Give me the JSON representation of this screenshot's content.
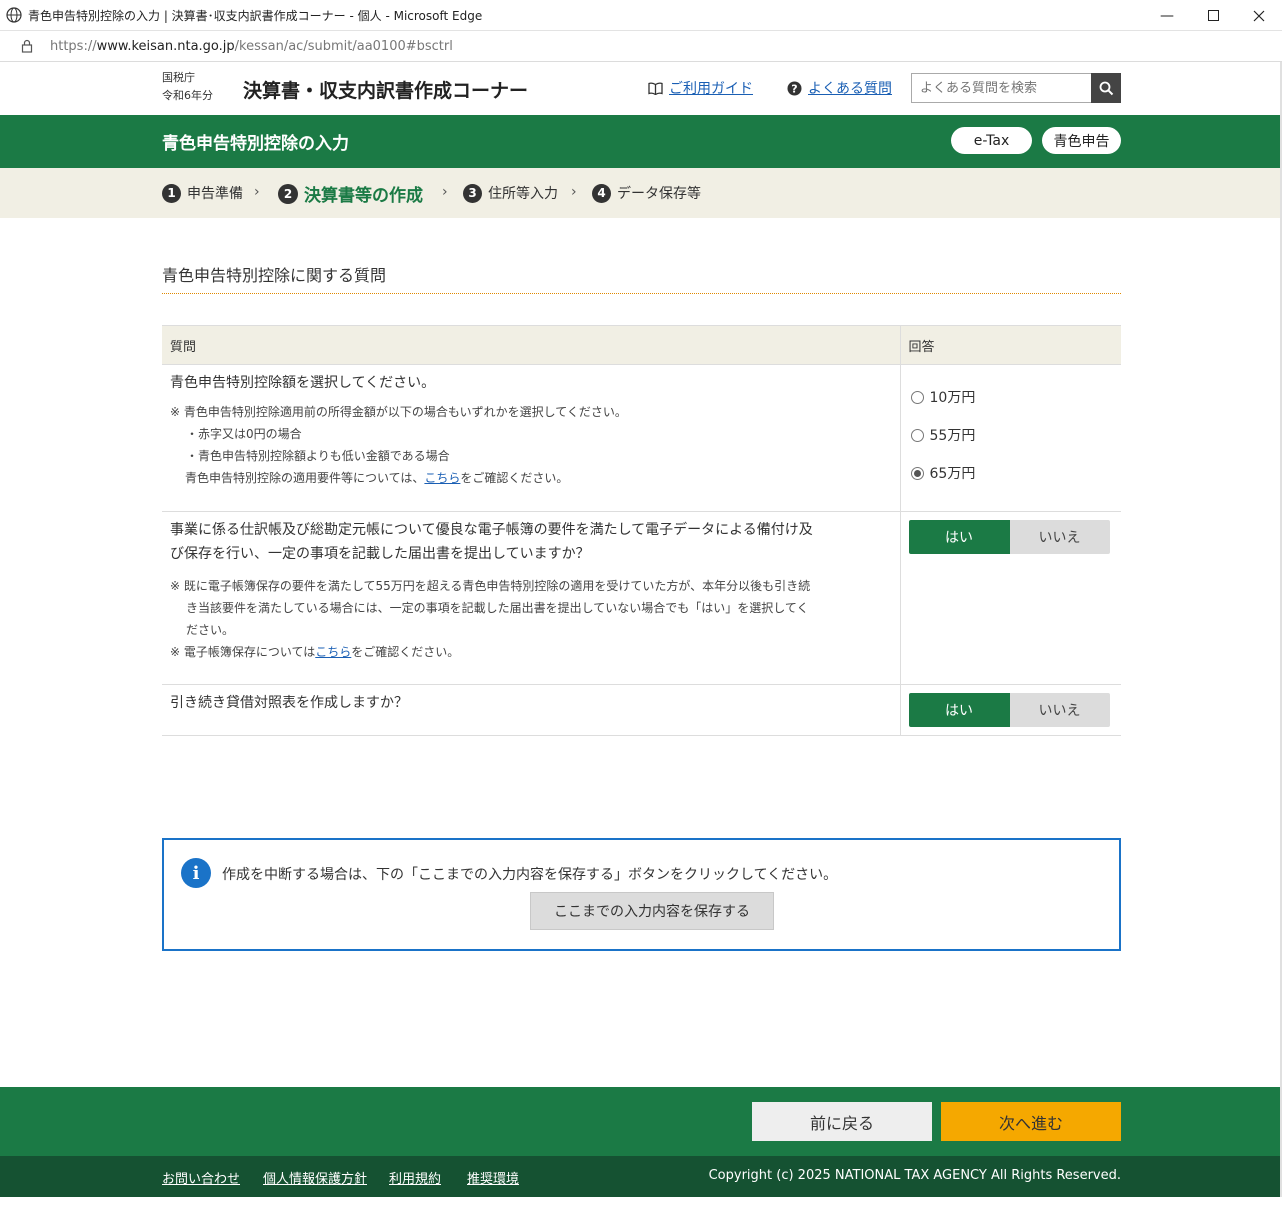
{
  "window": {
    "title": "青色申告特別控除の入力 | 決算書･収支内訳書作成コーナー - 個人 - Microsoft Edge",
    "url_prefix": "https://",
    "url_host": "www.keisan.nta.go.jp",
    "url_path": "/kessan/ac/submit/aa0100#bsctrl"
  },
  "header": {
    "agency": "国税庁",
    "year": "令和6年分",
    "corner_title": "決算書・収支内訳書作成コーナー",
    "guide_link": "ご利用ガイド",
    "faq_link": "よくある質問",
    "search_placeholder": "よくある質問を検索"
  },
  "band": {
    "page_title": "青色申告特別控除の入力",
    "etax_label": "e-Tax",
    "aoiro_label": "青色申告"
  },
  "steps": [
    {
      "num": "1",
      "label": "申告準備"
    },
    {
      "num": "2",
      "label": "決算書等の作成"
    },
    {
      "num": "3",
      "label": "住所等入力"
    },
    {
      "num": "4",
      "label": "データ保存等"
    }
  ],
  "main": {
    "section_title": "青色申告特別控除に関する質問",
    "col_question": "質問",
    "col_answer": "回答",
    "q1": {
      "text": "青色申告特別控除額を選択してください。",
      "note1": "※ 青色申告特別控除適用前の所得金額が以下の場合もいずれかを選択してください。",
      "note2": "・赤字又は0円の場合",
      "note3": "・青色申告特別控除額よりも低い金額である場合",
      "note4_pre": "青色申告特別控除の適用要件等については、",
      "note4_link": "こちら",
      "note4_post": "をご確認ください。",
      "options": [
        "10万円",
        "55万円",
        "65万円"
      ],
      "selected": "65万円"
    },
    "q2": {
      "text1": "事業に係る仕訳帳及び総勘定元帳について優良な電子帳簿の要件を満たして電子データによる備付け及",
      "text2": "び保存を行い、一定の事項を記載した届出書を提出していますか？",
      "note1": "※ 既に電子帳簿保存の要件を満たして55万円を超える青色申告特別控除の適用を受けていた方が、本年分以後も引き続",
      "note2": "き当該要件を満たしている場合には、一定の事項を記載した届出書を提出していない場合でも「はい」を選択してく",
      "note3": "ださい。",
      "note4_pre": "※ 電子帳簿保存については",
      "note4_link": "こちら",
      "note4_post": "をご確認ください。",
      "yes": "はい",
      "no": "いいえ",
      "selected": "はい"
    },
    "q3": {
      "text": "引き続き貸借対照表を作成しますか？",
      "yes": "はい",
      "no": "いいえ",
      "selected": "はい"
    }
  },
  "info": {
    "text": "作成を中断する場合は、下の「ここまでの入力内容を保存する」ボタンをクリックしてください。",
    "save_button": "ここまでの入力内容を保存する"
  },
  "nav": {
    "back": "前に戻る",
    "next": "次へ進む"
  },
  "footer": {
    "contact": "お問い合わせ",
    "privacy": "個人情報保護方針",
    "terms": "利用規約",
    "env": "推奨環境",
    "copyright": "Copyright (c) 2025 NATIONAL TAX AGENCY All Rights Reserved."
  },
  "colors": {
    "brand_green": "#1b7a45",
    "footer_green": "#155232",
    "next_orange": "#f5a800",
    "info_blue": "#1a73c8",
    "step_bg": "#f1efe4"
  }
}
